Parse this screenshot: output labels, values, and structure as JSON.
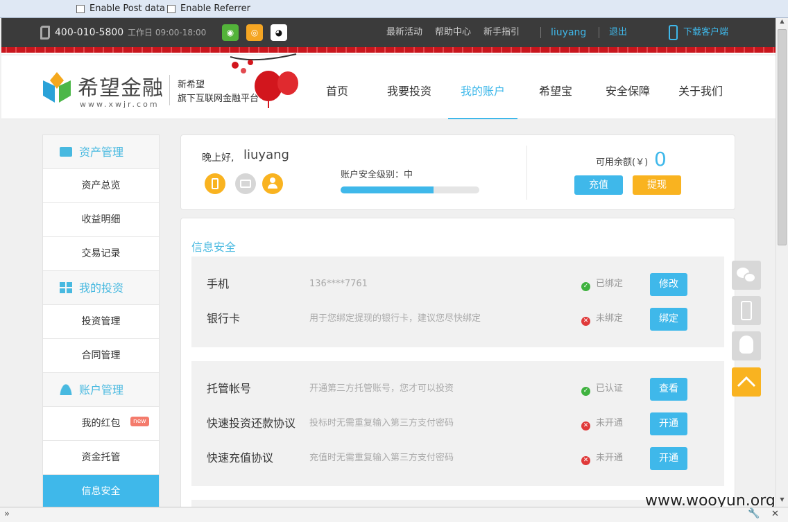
{
  "browser": {
    "ext_options": [
      "Enable Post data",
      "Enable Referrer"
    ]
  },
  "topbar": {
    "phone": "400-010-5800",
    "hours": "工作日 09:00-18:00",
    "social": [
      {
        "icon": "wechat-icon",
        "glyph": "◉",
        "color": "#53b33a"
      },
      {
        "icon": "weibo-icon",
        "glyph": "◎",
        "color": "#f5a623"
      },
      {
        "icon": "qq-icon",
        "glyph": "◕",
        "color": "#ffffff"
      }
    ],
    "links": [
      "最新活动",
      "帮助中心",
      "新手指引"
    ],
    "username": "liuyang",
    "logout": "退出",
    "download": "下载客户端"
  },
  "header": {
    "brand": "希望金融",
    "domain": "www.xwjr.com",
    "tagline1": "新希望",
    "tagline2": "旗下互联网金融平台",
    "nav": [
      "首页",
      "我要投资",
      "我的账户",
      "希望宝",
      "安全保障",
      "关于我们"
    ],
    "active_nav": "我的账户"
  },
  "sidebar": {
    "sections": [
      {
        "title": "资产管理",
        "icon": "wallet-icon",
        "items": [
          "资产总览",
          "收益明细",
          "交易记录"
        ]
      },
      {
        "title": "我的投资",
        "icon": "grid-icon",
        "items": [
          "投资管理",
          "合同管理"
        ]
      },
      {
        "title": "账户管理",
        "icon": "user-icon",
        "items": [
          "我的红包",
          "资金托管",
          "信息安全"
        ]
      }
    ],
    "new_badge": "new",
    "active_item": "信息安全"
  },
  "summary": {
    "greeting": "晚上好,",
    "username": "liuyang",
    "security_label": "账户安全级别：中",
    "security_level": 0.67,
    "balance_label": "可用余额(￥)",
    "balance": "0",
    "recharge": "充值",
    "withdraw": "提现"
  },
  "security": {
    "title": "信息安全",
    "group1": [
      {
        "name": "手机",
        "desc": "136****7761",
        "status": "已绑定",
        "ok": true,
        "action": "修改"
      },
      {
        "name": "银行卡",
        "desc": "用于您绑定提现的银行卡，建议您尽快绑定",
        "status": "未绑定",
        "ok": false,
        "action": "绑定"
      }
    ],
    "group2": [
      {
        "name": "托管帐号",
        "desc": "开通第三方托管账号，您才可以投资",
        "status": "已认证",
        "ok": true,
        "action": "查看"
      },
      {
        "name": "快速投资还款协议",
        "desc": "投标时无需重复输入第三方支付密码",
        "status": "未开通",
        "ok": false,
        "action": "开通"
      },
      {
        "name": "快速充值协议",
        "desc": "充值时无需重复输入第三方支付密码",
        "status": "未开通",
        "ok": false,
        "action": "开通"
      }
    ]
  },
  "watermark": "www.wooyun.org",
  "colors": {
    "accent": "#3fb8ea",
    "orange": "#f9b320",
    "ok": "#3fb23f",
    "bad": "#e03a3a"
  }
}
